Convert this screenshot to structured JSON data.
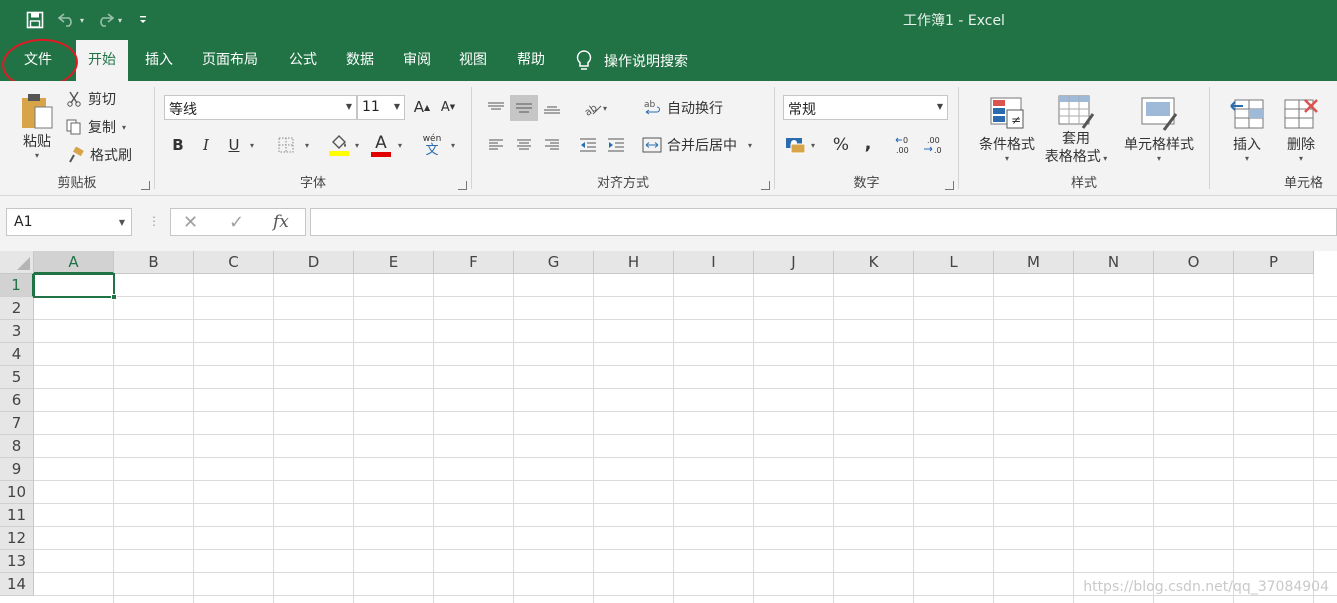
{
  "window": {
    "title": "工作簿1  -  Excel"
  },
  "tabs": [
    {
      "label": "文件"
    },
    {
      "label": "开始"
    },
    {
      "label": "插入"
    },
    {
      "label": "页面布局"
    },
    {
      "label": "公式"
    },
    {
      "label": "数据"
    },
    {
      "label": "审阅"
    },
    {
      "label": "视图"
    },
    {
      "label": "帮助"
    }
  ],
  "tell_me": "操作说明搜索",
  "clipboard": {
    "paste": "粘贴",
    "cut": "剪切",
    "copy": "复制",
    "format_painter": "格式刷",
    "label": "剪贴板"
  },
  "font": {
    "name": "等线",
    "size": "11",
    "label": "字体",
    "grow": "A",
    "shrink": "A",
    "bold": "B",
    "italic": "I",
    "underline": "U",
    "color_letter": "A",
    "phonetic_top": "wén",
    "phonetic_bottom": "文"
  },
  "alignment": {
    "wrap_text": "自动换行",
    "merge_center": "合并后居中",
    "label": "对齐方式"
  },
  "number": {
    "format": "常规",
    "label": "数字",
    "percent": "%",
    "comma": ","
  },
  "styles": {
    "conditional": "条件格式",
    "table_format_line1": "套用",
    "table_format_line2": "表格格式",
    "cell_styles": "单元格样式",
    "label": "样式"
  },
  "cells": {
    "insert": "插入",
    "delete": "删除",
    "label": "单元格"
  },
  "formula_bar": {
    "name_box": "A1",
    "fx": "fx"
  },
  "grid": {
    "columns": [
      "A",
      "B",
      "C",
      "D",
      "E",
      "F",
      "G",
      "H",
      "I",
      "J",
      "K",
      "L",
      "M",
      "N",
      "O",
      "P"
    ],
    "rows": [
      "1",
      "2",
      "3",
      "4",
      "5",
      "6",
      "7",
      "8",
      "9",
      "10",
      "11",
      "12",
      "13",
      "14"
    ],
    "active_cell": "A1"
  },
  "watermark": "https://blog.csdn.net/qq_37084904",
  "colors": {
    "brand": "#217346",
    "annotation": "#e01b24"
  }
}
